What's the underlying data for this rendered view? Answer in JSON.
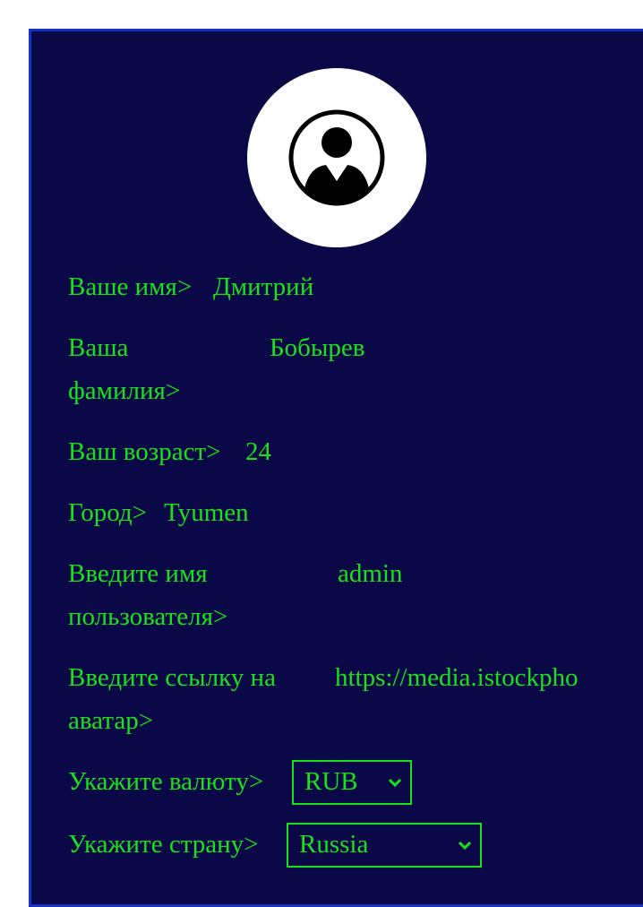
{
  "avatar": {
    "icon": "user-circle-icon"
  },
  "profile": {
    "name_label": "Ваше имя>",
    "name_value": "Дмитрий",
    "surname_label": "Ваша фамилия>",
    "surname_value": "Бобырев",
    "age_label": "Ваш возраст>",
    "age_value": "24",
    "city_label": "Город>",
    "city_value": "Tyumen",
    "username_label": "Введите имя пользователя>",
    "username_value": "admin",
    "avatar_link_label": "Введите ссылку на аватар>",
    "avatar_link_value": "https://media.istockpho",
    "currency_label": "Укажите валюту>",
    "currency_value": "RUB",
    "country_label": "Укажите страну>",
    "country_value": "Russia"
  },
  "colors": {
    "background": "#0a0846",
    "text": "#19e21c",
    "border": "#1533c4"
  }
}
